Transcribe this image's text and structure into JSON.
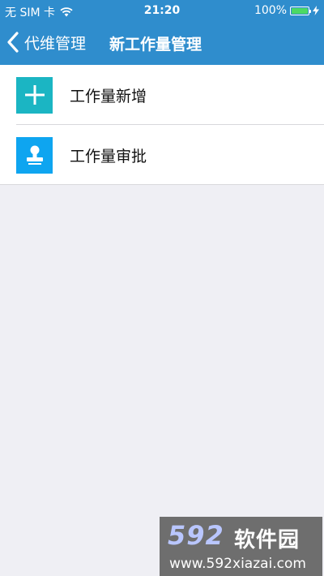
{
  "status_bar": {
    "carrier": "无 SIM 卡",
    "time": "21:20",
    "battery": "100%",
    "battery_level": 1.0,
    "icons": [
      "wifi-icon",
      "battery-icon",
      "charging-icon"
    ]
  },
  "nav": {
    "back_label": "代维管理",
    "title": "新工作量管理",
    "color": "#2f8dcd"
  },
  "menu": {
    "items": [
      {
        "label": "工作量新增",
        "icon": "plus-icon",
        "icon_color": "#1bb5c3"
      },
      {
        "label": "工作量审批",
        "icon": "stamp-icon",
        "icon_color": "#0ea5f0"
      }
    ]
  },
  "watermark": {
    "logo": "592",
    "text": "软件园",
    "url": "www.592xiazai.com"
  }
}
